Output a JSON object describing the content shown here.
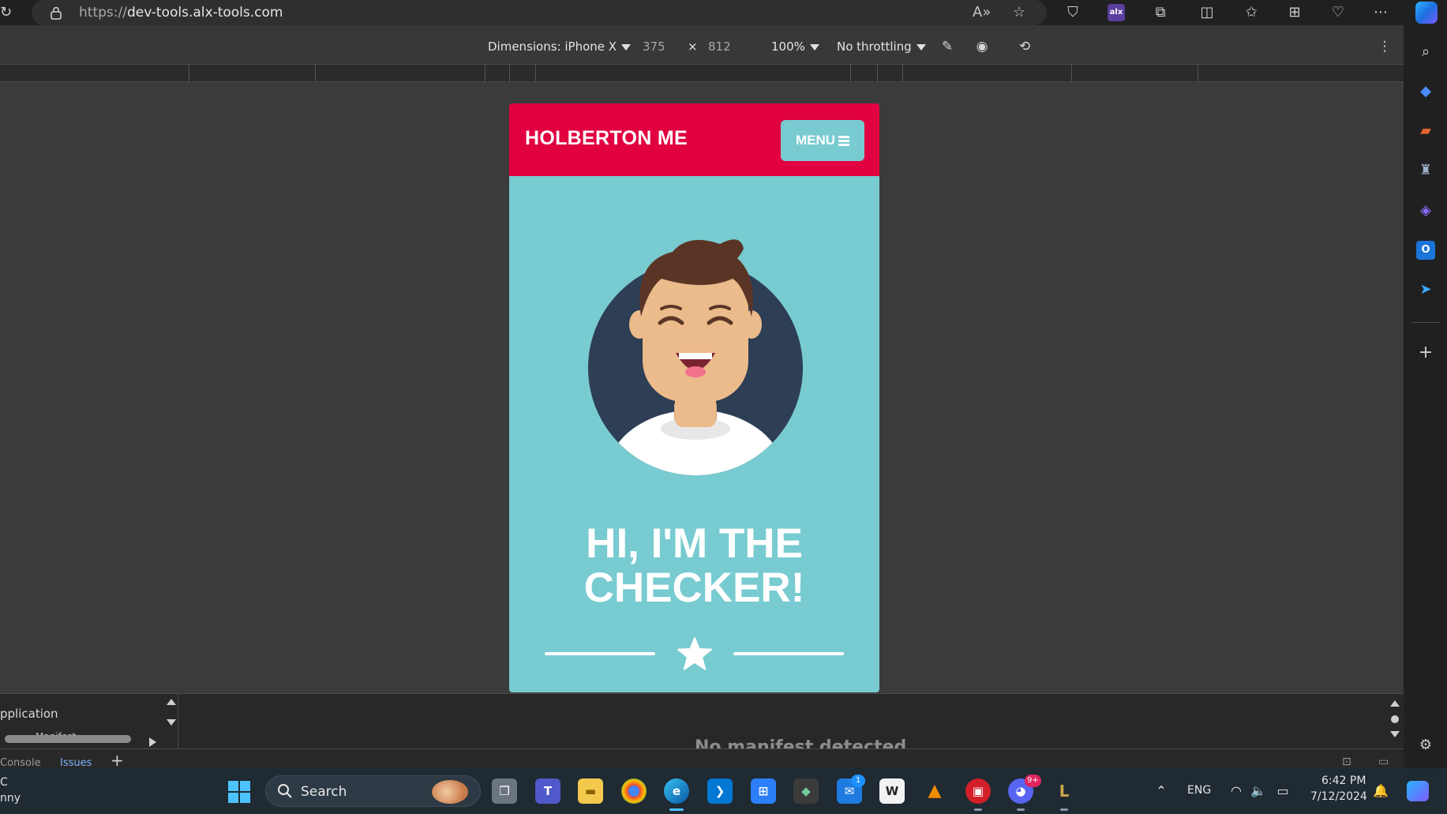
{
  "browser": {
    "url_scheme": "https://",
    "url_host": "dev-tools.alx-tools.com",
    "extension_badge": "alx",
    "icons": [
      "reload-icon",
      "lock-icon",
      "read-aloud-icon",
      "favorite-star-icon",
      "shield-icon",
      "alx-extension-icon",
      "extensions-icon",
      "split-screen-icon",
      "favorites-icon",
      "collections-icon",
      "browser-essentials-icon",
      "more-icon",
      "copilot-icon"
    ]
  },
  "device_toolbar": {
    "dimensions_label": "Dimensions: iPhone X",
    "width": "375",
    "times": "×",
    "height": "812",
    "zoom": "100%",
    "throttling": "No throttling"
  },
  "page": {
    "site_title": "HOLBERTON ME",
    "menu_label": "MENU",
    "hero_line1": "HI, I'M THE",
    "hero_line2": "CHECKER!",
    "colors": {
      "header": "#e10040",
      "body": "#78cbd0",
      "avatar_bg": "#2d3e55",
      "skin": "#ecbb8b",
      "hair": "#5a3526"
    }
  },
  "drawer": {
    "panel_title": "pplication",
    "panel_item": "Manifest",
    "message": "No manifest detected",
    "tabs": [
      "Console",
      "Issues"
    ],
    "add_tab": "+"
  },
  "taskbar": {
    "left_line1": "C",
    "left_line2": "nny",
    "search_placeholder": "Search",
    "language": "ENG",
    "time": "6:42 PM",
    "date": "7/12/2024",
    "mail_badge": "1",
    "discord_badge": "9+"
  }
}
